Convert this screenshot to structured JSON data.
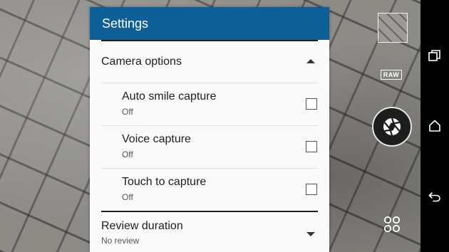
{
  "settings": {
    "title": "Settings",
    "camera_options": {
      "title": "Camera options",
      "expanded": true,
      "items": [
        {
          "label": "Auto smile capture",
          "status": "Off",
          "checked": false
        },
        {
          "label": "Voice capture",
          "status": "Off",
          "checked": false
        },
        {
          "label": "Touch to capture",
          "status": "Off",
          "checked": false
        }
      ]
    },
    "review_duration": {
      "label": "Review duration",
      "value": "No review"
    }
  },
  "camera_controls": {
    "raw_badge": "RAW",
    "icons": {
      "thumbnail": "gallery-thumbnail",
      "shutter": "aperture-icon",
      "modes": "mode-grid-icon"
    }
  },
  "nav": {
    "icons": [
      "recent-apps-icon",
      "home-icon",
      "back-icon"
    ]
  },
  "colors": {
    "header": "#0e5f95",
    "panel": "#fafafa",
    "nav_bar": "#000000"
  }
}
